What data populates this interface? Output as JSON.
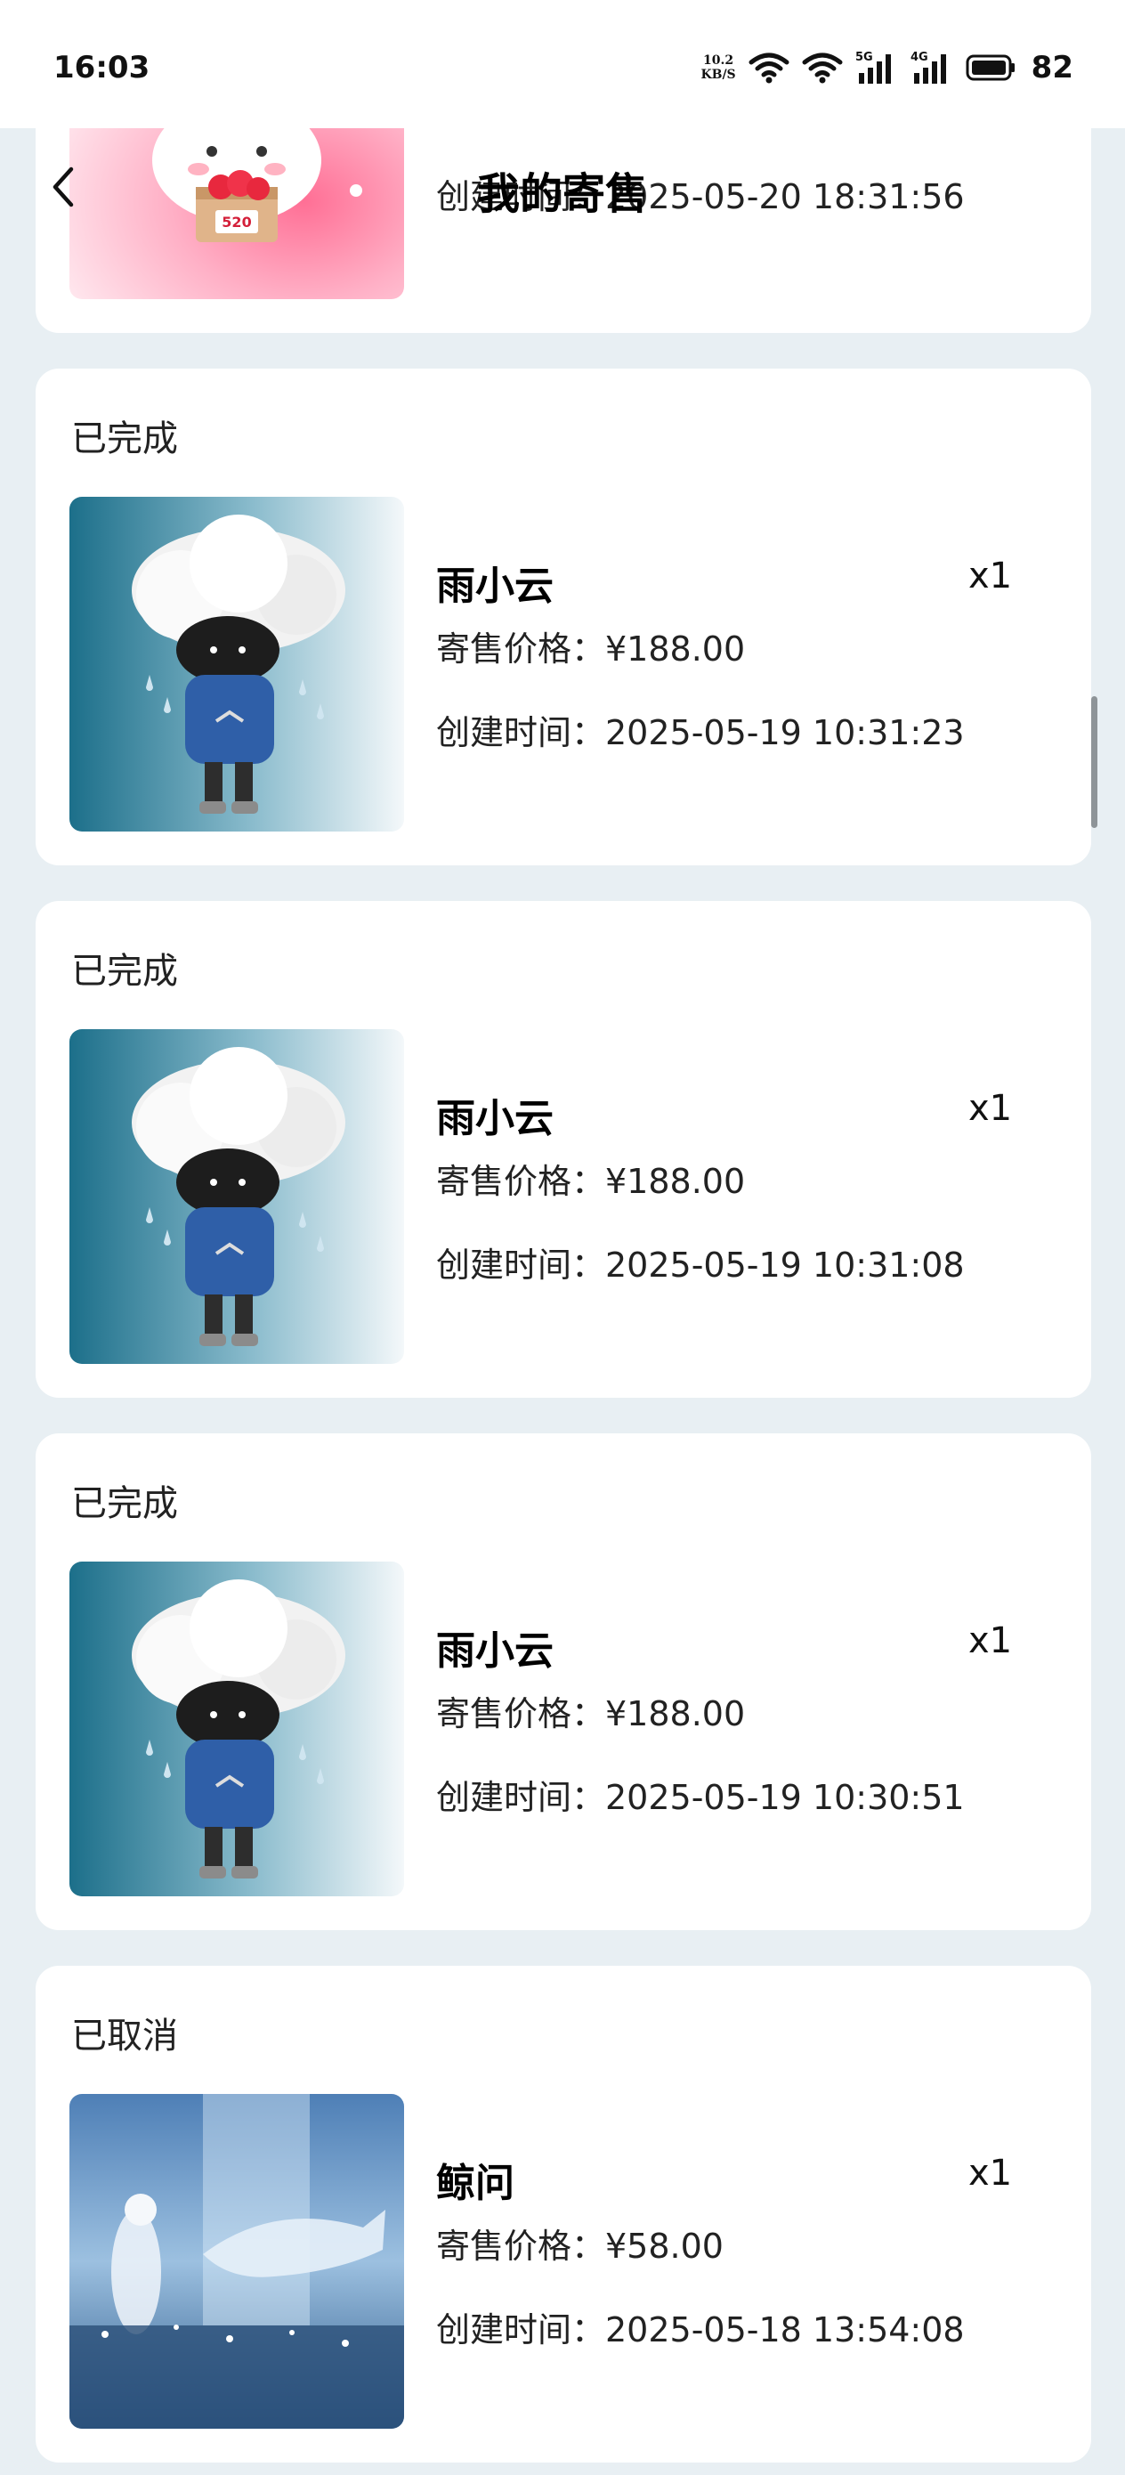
{
  "status_bar": {
    "time": "16:03",
    "net_speed_value": "10.2",
    "net_speed_unit": "KB/S",
    "signal_1_label": "5G",
    "signal_2_label": "4G",
    "battery_level": "82",
    "icons": [
      "wifi-icon",
      "wifi-icon",
      "signal-5g-icon",
      "signal-4g-icon",
      "battery-icon"
    ]
  },
  "header": {
    "title": "我的寄售",
    "back_icon": "chevron-left-icon"
  },
  "top_partial_card": {
    "time_line": "创建时间：2025-05-20 18:31:56"
  },
  "orders": [
    {
      "status": "已完成",
      "name": "雨小云",
      "quantity": "x1",
      "price": "寄售价格：¥188.00",
      "created": "创建时间：2025-05-19 10:31:23"
    },
    {
      "status": "已完成",
      "name": "雨小云",
      "quantity": "x1",
      "price": "寄售价格：¥188.00",
      "created": "创建时间：2025-05-19 10:31:08"
    },
    {
      "status": "已完成",
      "name": "雨小云",
      "quantity": "x1",
      "price": "寄售价格：¥188.00",
      "created": "创建时间：2025-05-19 10:30:51"
    },
    {
      "status": "已取消",
      "name": "鲸问",
      "quantity": "x1",
      "price": "寄售价格：¥58.00",
      "created": "创建时间：2025-05-18 13:54:08"
    }
  ],
  "colors": {
    "page_bg": "#e8eff3",
    "card_bg": "#ffffff",
    "text_primary": "#000000"
  }
}
